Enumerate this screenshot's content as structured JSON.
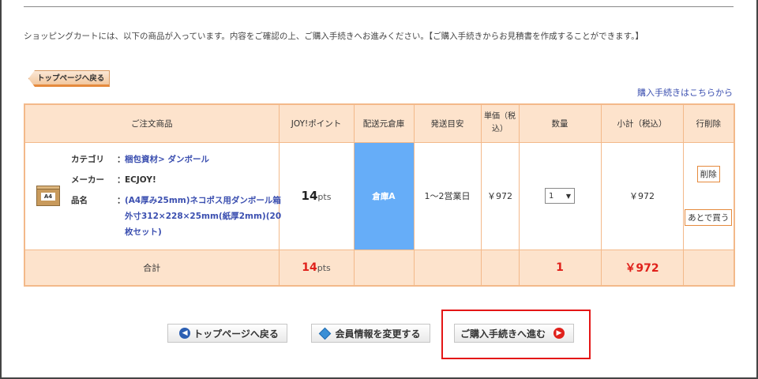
{
  "intro_text": "ショッピングカートには、以下の商品が入っています。内容をご確認の上、ご購入手続きへお進みください。【ご購入手続きからお見積書を作成することができます。】",
  "back_tab_label": "トップページへ戻る",
  "checkout_link_label": "購入手続きはこちらから",
  "table": {
    "headers": {
      "product": "ご注文商品",
      "points": "JOY!ポイント",
      "warehouse": "配送元倉庫",
      "delivery": "発送目安",
      "unit_price": "単価（税込）",
      "quantity": "数量",
      "subtotal": "小計（税込）",
      "delete": "行削除"
    },
    "item": {
      "image_label": "A4",
      "category_label": "カテゴリ",
      "category_value": "梱包資材> ダンボール",
      "maker_label": "メーカー",
      "maker_value": "ECJOY!",
      "name_label": "品名",
      "name_value": "(A4厚み25mm)ネコポス用ダンボール箱 外寸312×228×25mm(紙厚2mm)(20枚セット)",
      "colon": "：",
      "points_value": "14",
      "points_unit": "pts",
      "warehouse": "倉庫A",
      "delivery": "1～2営業日",
      "unit_price": "￥972",
      "quantity": "1",
      "quantity_arrow": "▼",
      "subtotal": "￥972",
      "delete_button": "削除",
      "later_button": "あとで買う"
    },
    "total": {
      "label": "合計",
      "points_value": "14",
      "points_unit": "pts",
      "quantity": "1",
      "amount": "￥972"
    }
  },
  "buttons": {
    "back_label": "トップページへ戻る",
    "back_icon": "◀",
    "member_label": "会員情報を変更する",
    "proceed_label": "ご購入手続きへ進む",
    "proceed_icon": "▶"
  },
  "colors": {
    "table_header_bg": "#fde3cc",
    "table_border": "#f3b98a",
    "warehouse_bg": "#66adf8",
    "accent_red": "#e0211b",
    "link_blue": "#3b4fb0",
    "highlight_border": "#e41616"
  }
}
